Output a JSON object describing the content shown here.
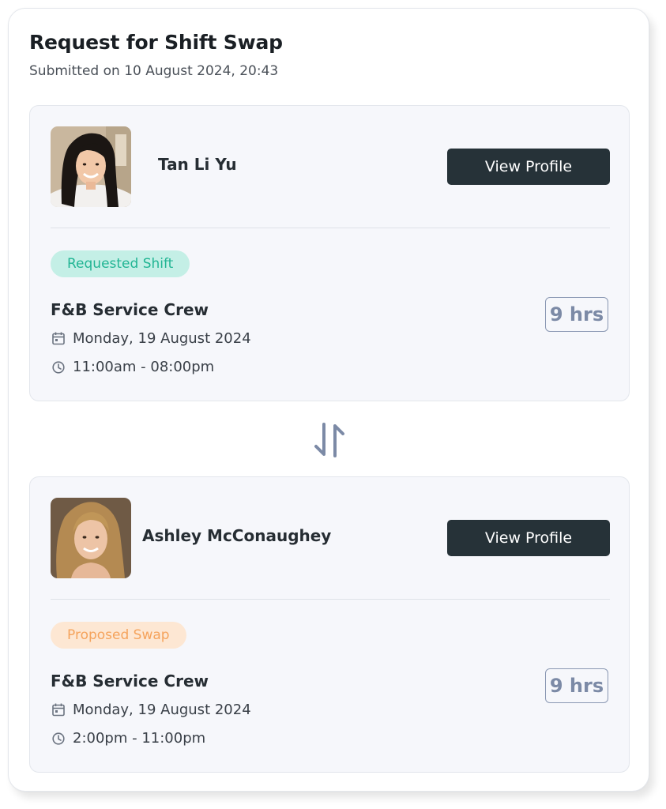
{
  "header": {
    "title": "Request for Shift Swap",
    "submitted": "Submitted on 10 August 2024, 20:43"
  },
  "colors": {
    "button_bg": "#263238",
    "requested_badge_bg": "#c4efe6",
    "requested_badge_text": "#22b594",
    "proposed_badge_bg": "#fde7d3",
    "proposed_badge_text": "#f5a35c",
    "hours_accent": "#7c8aa6",
    "panel_bg": "#f6f7fb"
  },
  "requester": {
    "name": "Tan Li Yu",
    "view_label": "View Profile",
    "badge": "Requested Shift",
    "role": "F&B Service Crew",
    "date": "Monday, 19 August 2024",
    "time": "11:00am - 08:00pm",
    "hours": "9 hrs",
    "avatar_icon": "person-photo"
  },
  "swap_icon": "swap-arrows-icon",
  "proposer": {
    "name": "Ashley McConaughey",
    "view_label": "View Profile",
    "badge": "Proposed Swap",
    "role": "F&B Service Crew",
    "date": "Monday, 19 August 2024",
    "time": "2:00pm - 11:00pm",
    "hours": "9 hrs",
    "avatar_icon": "person-photo"
  }
}
